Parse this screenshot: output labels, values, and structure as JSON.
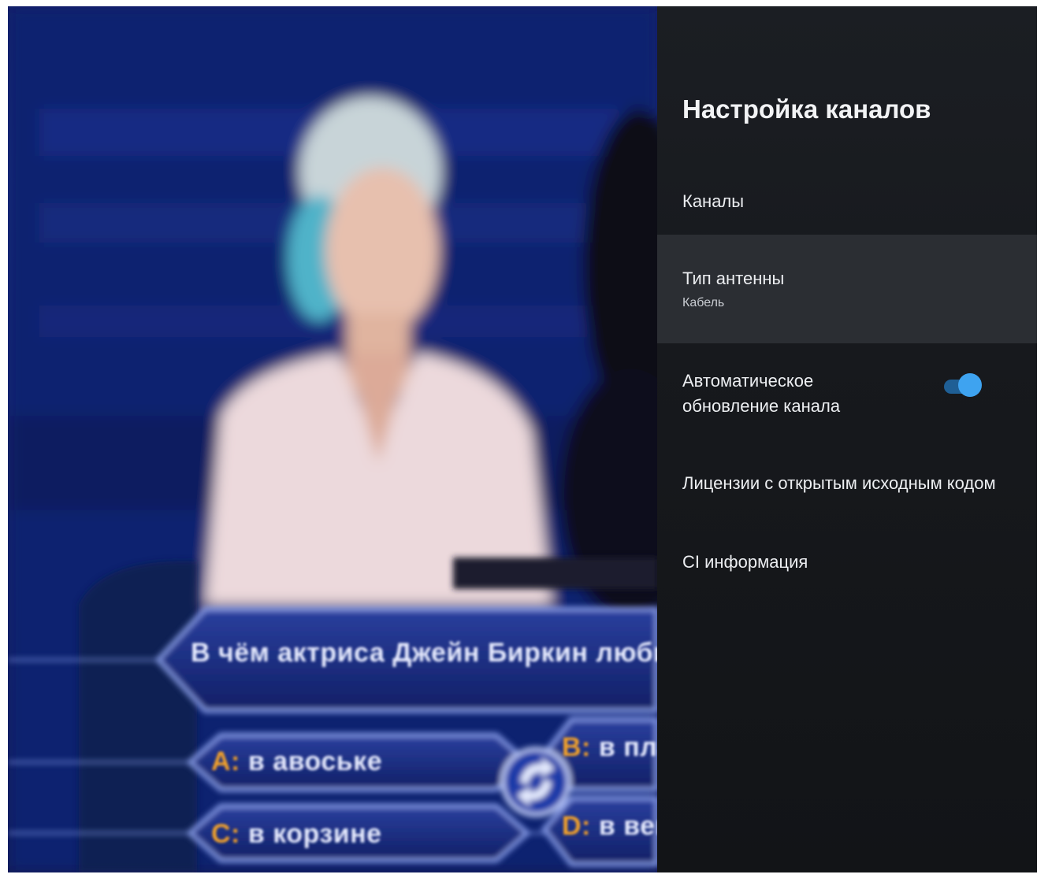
{
  "tv_picture": {
    "quiz": {
      "question": "В чём актриса Джейн Биркин любила носить свои",
      "answers": [
        {
          "letter": "A:",
          "text": "в авоське"
        },
        {
          "letter": "B:",
          "text": "в плас"
        },
        {
          "letter": "C:",
          "text": "в корзине"
        },
        {
          "letter": "D:",
          "text": "в веще"
        }
      ]
    }
  },
  "settings": {
    "title": "Настройка каналов",
    "items": [
      {
        "label": "Каналы"
      },
      {
        "label": "Тип антенны",
        "value": "Кабель"
      },
      {
        "label": "Автоматическое обновление канала",
        "toggle_on": true
      },
      {
        "label": "Лицензии с открытым исходным кодом"
      },
      {
        "label": "CI информация"
      }
    ]
  },
  "colors": {
    "panel_bg": "#17191d",
    "selected_row": "#2b2e33",
    "toggle_on": "#3ea3f0",
    "studio_blue": "#0e2270"
  }
}
